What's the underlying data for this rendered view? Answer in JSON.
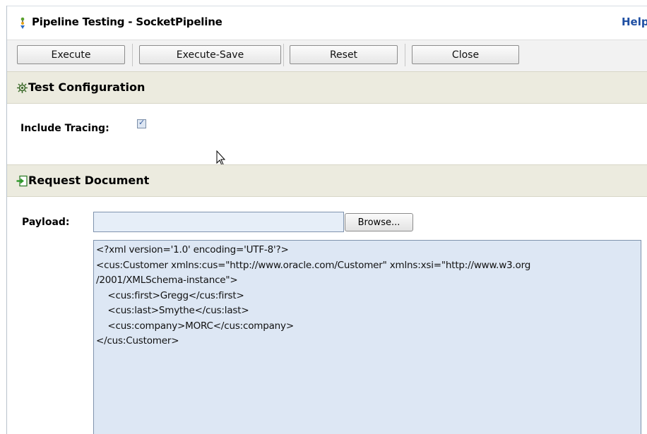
{
  "window": {
    "title": "Pipeline Testing - SocketPipeline",
    "help": "Help"
  },
  "toolbar": {
    "execute": "Execute",
    "execute_save": "Execute-Save",
    "reset": "Reset",
    "close": "Close"
  },
  "test_configuration": {
    "title": "Test Configuration",
    "include_tracing_label": "Include Tracing:",
    "include_tracing_checked": true
  },
  "request_document": {
    "title": "Request Document",
    "payload_label": "Payload:",
    "payload_value": "",
    "browse": "Browse...",
    "xml_lines": [
      "<?xml version='1.0' encoding='UTF-8'?>",
      "<cus:Customer xmlns:cus=\"http://www.oracle.com/Customer\" xmlns:xsi=\"http://www.w3.org",
      "/2001/XMLSchema-instance\">",
      "    <cus:first>Gregg</cus:first>",
      "    <cus:last>Smythe</cus:last>",
      "    <cus:company>MORC</cus:company>",
      "</cus:Customer>"
    ]
  },
  "colors": {
    "section_header_bg": "#ecebdf",
    "input_bg": "#dde7f4",
    "help_link": "#1f4fa3"
  }
}
